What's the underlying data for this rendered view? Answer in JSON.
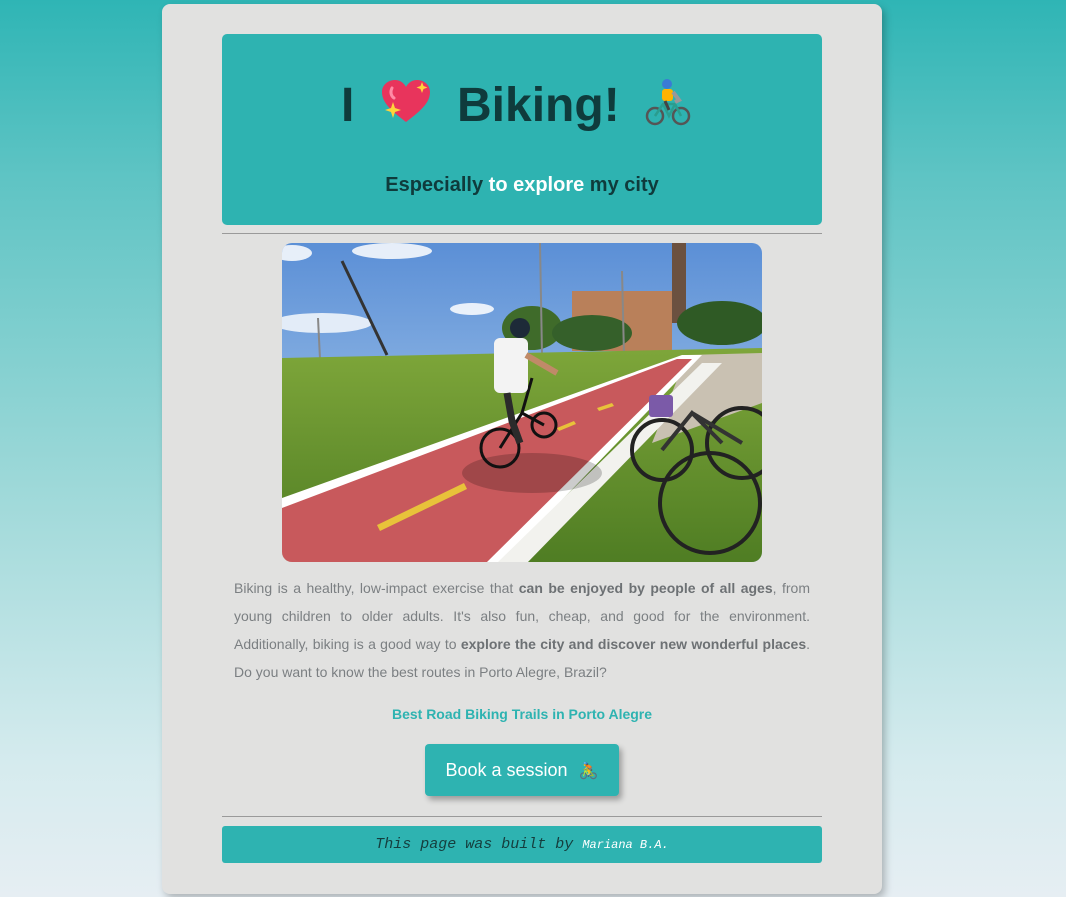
{
  "header": {
    "title_start": "I",
    "title_heart_emoji": "💖",
    "title_word": "Biking!",
    "title_bike_emoji": "🚴",
    "subtitle_part1": "Especially",
    "subtitle_highlight": "to explore",
    "subtitle_part2": "my city"
  },
  "photo": {
    "icon": "cyclist-on-bike-lane-photo"
  },
  "intro": {
    "t1": "Biking is a healthy, low-impact exercise that ",
    "b1": "can be enjoyed by people of all ages",
    "t2": ", from young children to older adults. It's also fun, cheap, and good for the environment. Additionally, biking is a good way to ",
    "b2": "explore the city and discover new wonderful places",
    "t3": ". Do you want to know the best routes in Porto Alegre, Brazil?"
  },
  "link": {
    "label": "Best Road Biking Trails in Porto Alegre"
  },
  "cta": {
    "label": "Book a session",
    "emoji": "🚴"
  },
  "footer": {
    "text": "This page was built by",
    "author": "Mariana B.A."
  },
  "colors": {
    "accent": "#2eb3b1",
    "card": "#e1e1e0",
    "dark_text": "#0f3b3c"
  }
}
